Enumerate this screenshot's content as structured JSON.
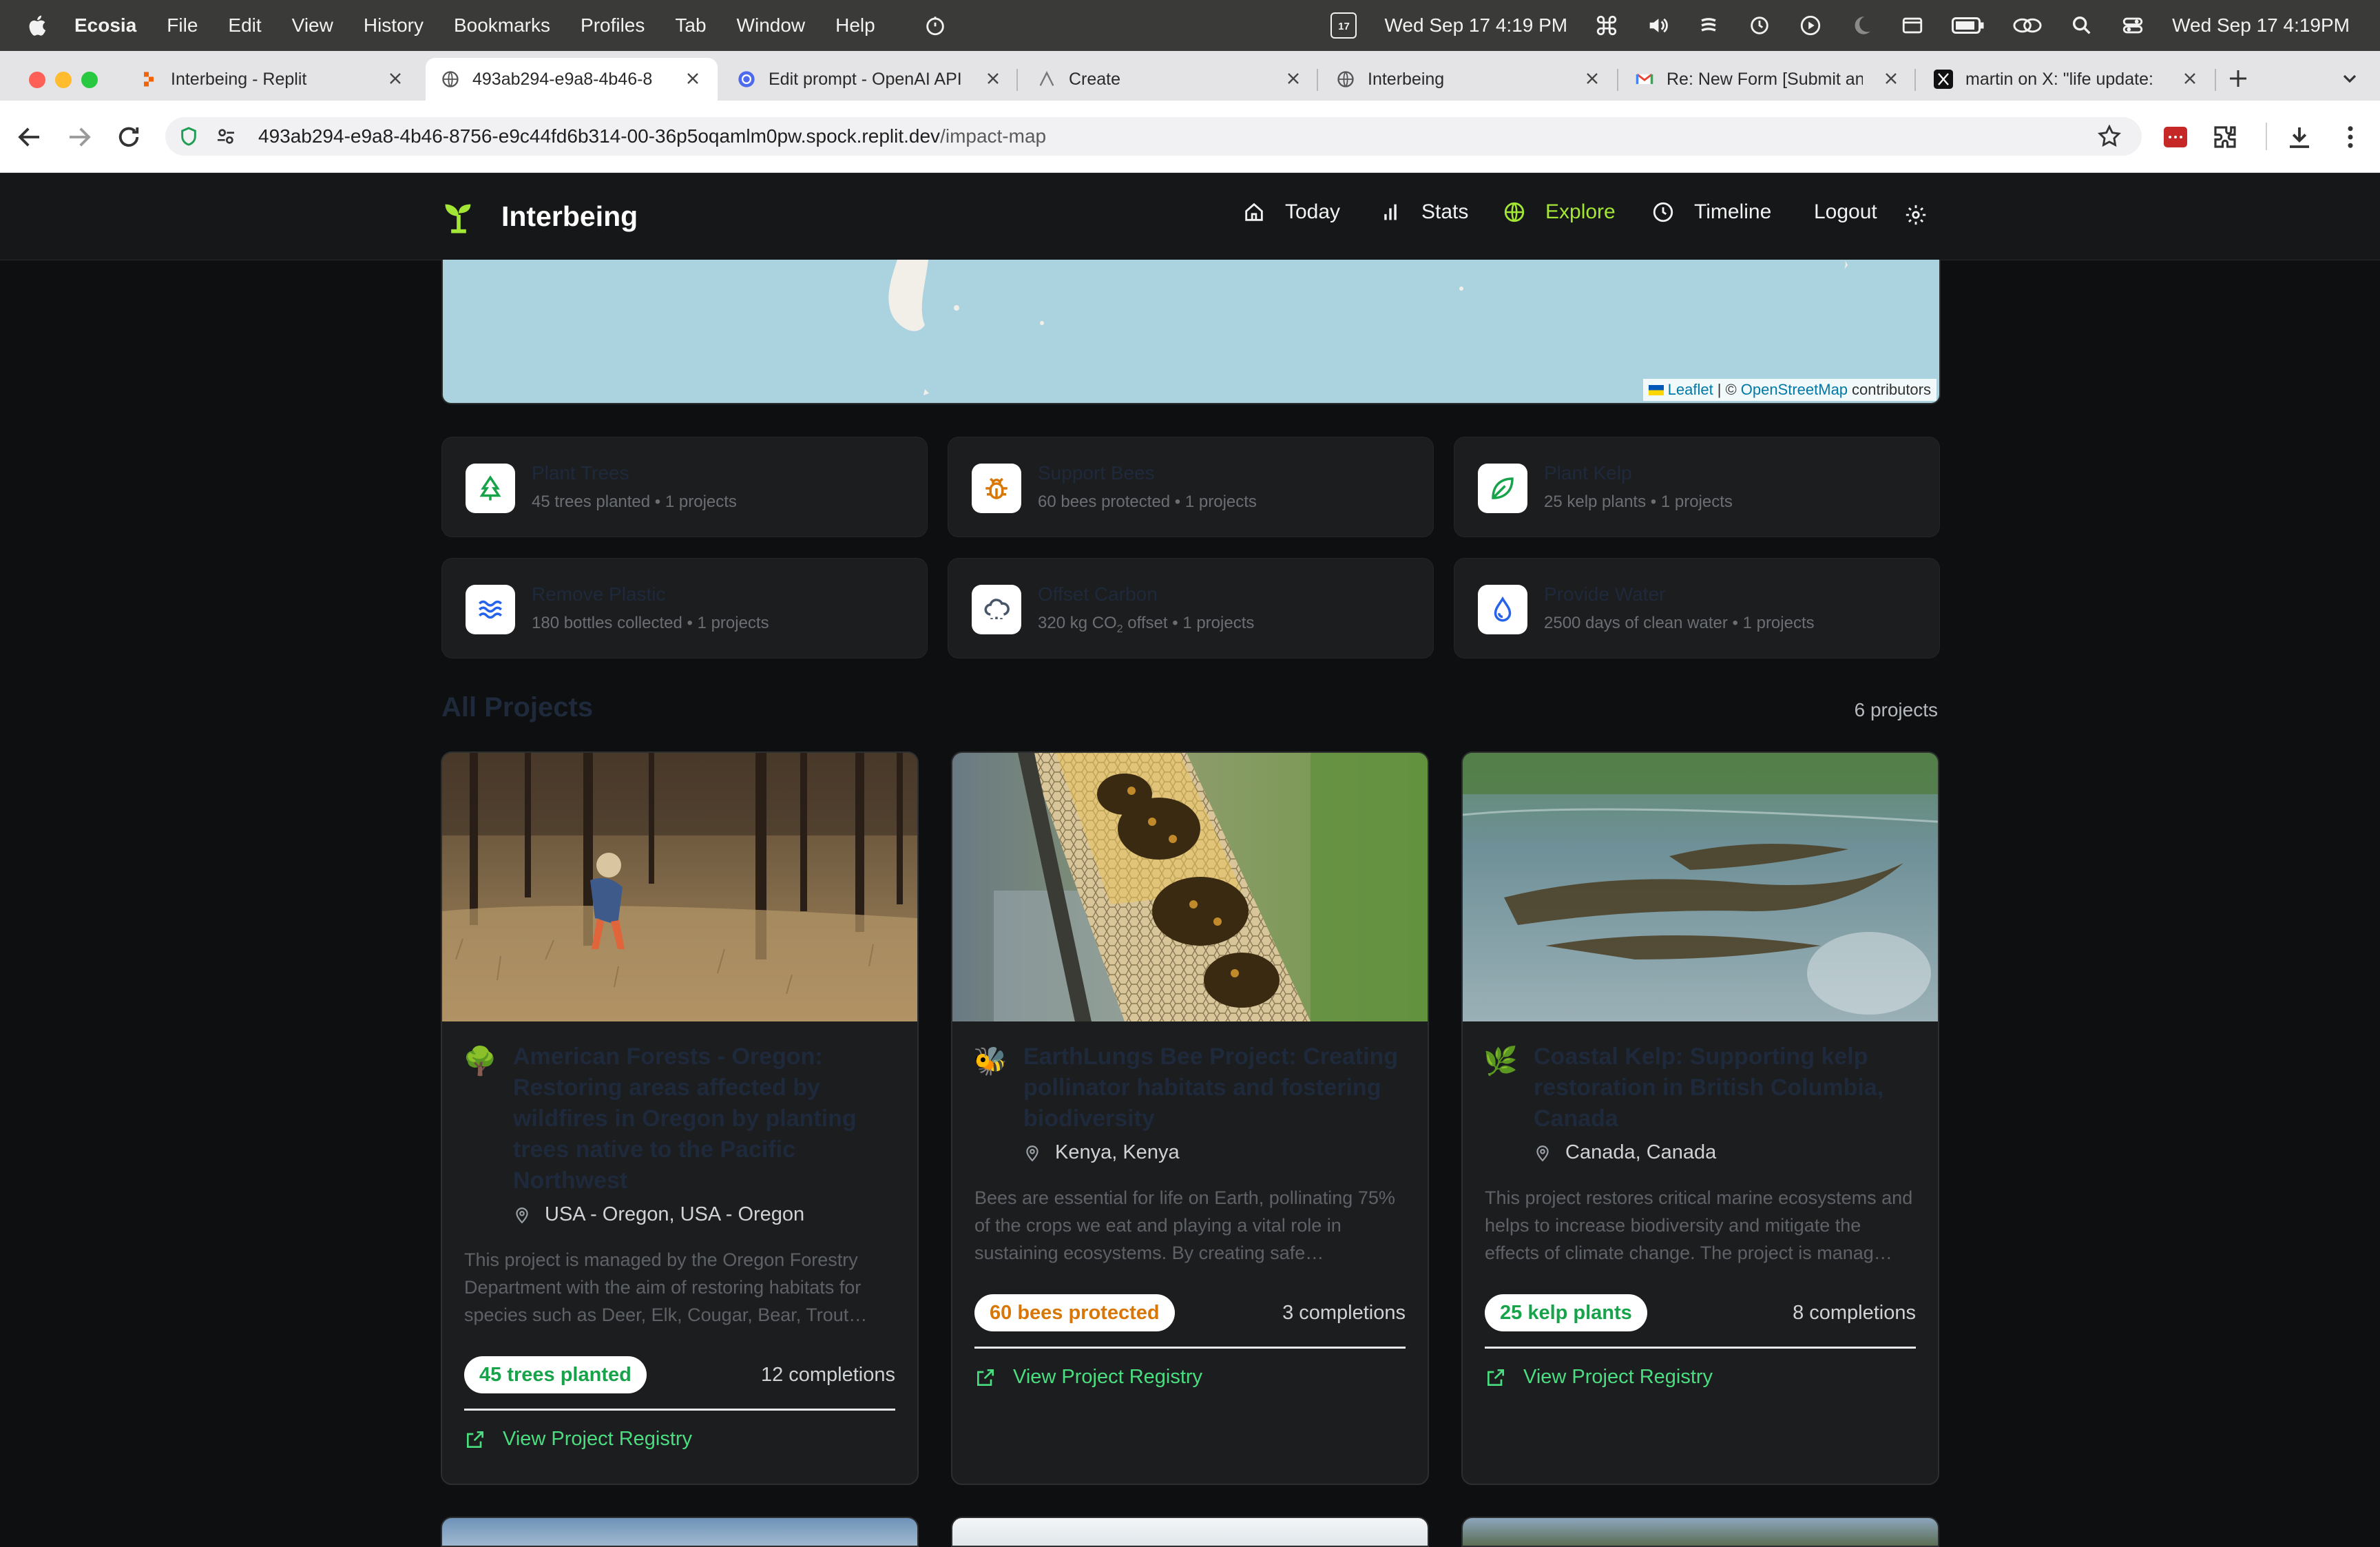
{
  "menubar": {
    "app": "Ecosia",
    "items": [
      "File",
      "Edit",
      "View",
      "History",
      "Bookmarks",
      "Profiles",
      "Tab",
      "Window",
      "Help"
    ],
    "calendar_day": "17",
    "datetime_left": "Wed Sep 17  4:19 PM",
    "datetime_right": "Wed Sep 17  4:19PM"
  },
  "tabs": [
    {
      "title": "Interbeing - Replit",
      "favicon": "replit-icon"
    },
    {
      "title": "493ab294-e9a8-4b46-8",
      "favicon": "globe-icon"
    },
    {
      "title": "Edit prompt - OpenAI API",
      "favicon": "openai-icon"
    },
    {
      "title": "Create",
      "favicon": "create-icon"
    },
    {
      "title": "Interbeing",
      "favicon": "globe-icon"
    },
    {
      "title": "Re: New Form [Submit an",
      "favicon": "gmail-icon"
    },
    {
      "title": "martin on X: \"life update:",
      "favicon": "x-icon"
    }
  ],
  "toolbar": {
    "url_host": "493ab294-e9a8-4b46-8756-e9c44fd6b314-00-36p5oqamlm0pw.spock.replit.dev",
    "url_path": "/impact-map"
  },
  "header": {
    "brand": "Interbeing",
    "nav": {
      "today": "Today",
      "stats": "Stats",
      "explore": "Explore",
      "timeline": "Timeline",
      "logout": "Logout"
    }
  },
  "map": {
    "attribution_leaflet": "Leaflet",
    "attribution_sep": "| ©",
    "attribution_osm": "OpenStreetMap",
    "attribution_tail": "contributors"
  },
  "impact": [
    {
      "title": "Plant Trees",
      "subtitle": "45 trees planted • 1 projects",
      "icon": "tree-icon",
      "color": "#16a34a"
    },
    {
      "title": "Support Bees",
      "subtitle": "60 bees protected • 1 projects",
      "icon": "bug-icon",
      "color": "#d97706"
    },
    {
      "title": "Plant Kelp",
      "subtitle": "25 kelp plants • 1 projects",
      "icon": "leaf-icon",
      "color": "#16a34a"
    },
    {
      "title": "Remove Plastic",
      "subtitle": "180 bottles collected • 1 projects",
      "icon": "waves-icon",
      "color": "#2563eb"
    },
    {
      "title": "Offset Carbon",
      "subtitle_pre": "320 kg CO",
      "subtitle_sub": "2",
      "subtitle_post": " offset • 1 projects",
      "icon": "cloud-icon",
      "color": "#475569"
    },
    {
      "title": "Provide Water",
      "subtitle": "2500 days of clean water • 1 projects",
      "icon": "droplet-icon",
      "color": "#2563eb"
    }
  ],
  "projects_section": {
    "title": "All Projects",
    "count": "6 projects"
  },
  "projects": [
    {
      "emoji": "🌳",
      "title": "American Forests - Oregon: Restoring areas affected by wildfires in Oregon by planting trees native to the Pacific Northwest",
      "location": "USA - Oregon, USA - Oregon",
      "description": "This project is managed by the Oregon Forestry Department with the aim of restoring habitats for species such as Deer, Elk, Cougar, Bear, Trout…",
      "badge": "45 trees planted",
      "badge_color": "#16a34a",
      "completions": "12 completions",
      "link": "View Project Registry"
    },
    {
      "emoji": "🐝",
      "title": "EarthLungs Bee Project: Creating pollinator habitats and fostering biodiversity",
      "location": "Kenya, Kenya",
      "description": "Bees are essential for life on Earth, pollinating 75% of the crops we eat and playing a vital role in sustaining ecosystems. By creating safe…",
      "badge": "60 bees protected",
      "badge_color": "#d97706",
      "completions": "3 completions",
      "link": "View Project Registry"
    },
    {
      "emoji": "🌿",
      "title": "Coastal Kelp: Supporting kelp restoration in British Columbia, Canada",
      "location": "Canada, Canada",
      "description": "This project restores critical marine ecosystems and helps to increase biodiversity and mitigate the effects of climate change. The project is manag…",
      "badge": "25 kelp plants",
      "badge_color": "#16a34a",
      "completions": "8 completions",
      "link": "View Project Registry"
    }
  ]
}
